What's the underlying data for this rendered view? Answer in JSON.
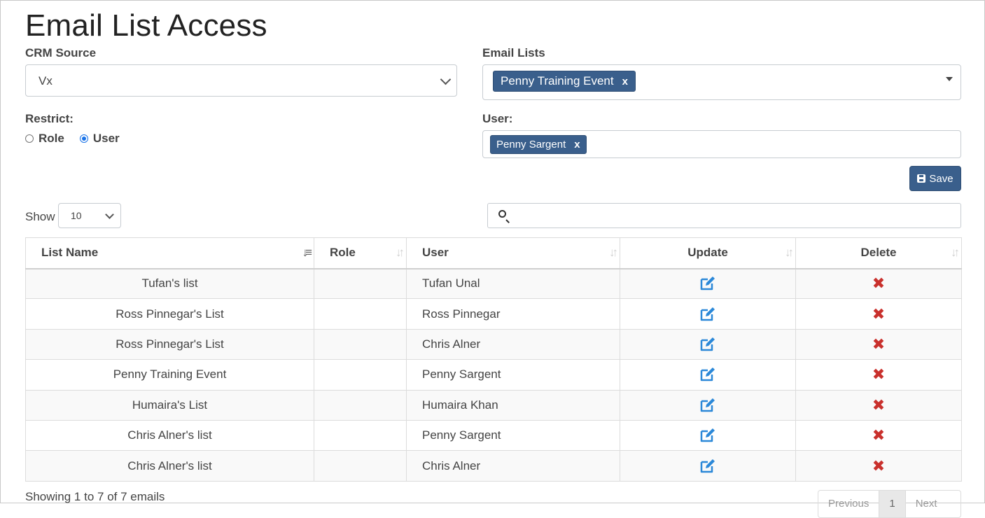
{
  "page": {
    "title": "Email List Access"
  },
  "crm_source": {
    "label": "CRM Source",
    "value": "Vx"
  },
  "email_lists": {
    "label": "Email Lists",
    "tags": [
      {
        "text": "Penny Training Event",
        "remove": "x"
      }
    ]
  },
  "restrict": {
    "label": "Restrict:",
    "options": [
      {
        "label": "Role",
        "selected": false
      },
      {
        "label": "User",
        "selected": true
      }
    ]
  },
  "user": {
    "label": "User:",
    "tags": [
      {
        "text": "Penny Sargent",
        "remove": "x"
      }
    ]
  },
  "save_button": {
    "label": "Save"
  },
  "length": {
    "label": "Show",
    "value": "10"
  },
  "search": {
    "value": ""
  },
  "table": {
    "columns": [
      "List Name",
      "Role",
      "User",
      "Update",
      "Delete"
    ],
    "rows": [
      {
        "list_name": "Tufan's list",
        "role": "",
        "user": "Tufan Unal"
      },
      {
        "list_name": "Ross Pinnegar's List",
        "role": "",
        "user": "Ross Pinnegar"
      },
      {
        "list_name": "Ross Pinnegar's List",
        "role": "",
        "user": "Chris Alner"
      },
      {
        "list_name": "Penny Training Event",
        "role": "",
        "user": "Penny Sargent"
      },
      {
        "list_name": "Humaira's List",
        "role": "",
        "user": "Humaira Khan"
      },
      {
        "list_name": "Chris Alner's list",
        "role": "",
        "user": "Penny Sargent"
      },
      {
        "list_name": "Chris Alner's list",
        "role": "",
        "user": "Chris Alner"
      }
    ]
  },
  "footer": {
    "info": "Showing 1 to 7 of 7 emails",
    "pager": [
      "Previous",
      "1",
      "Next"
    ]
  },
  "colors": {
    "accent": "#3a5f8c",
    "edit": "#2b88d8",
    "delete": "#c9302c"
  },
  "icons": {
    "update": "edit-icon",
    "delete": "delete-x-icon",
    "save": "floppy-disk-icon",
    "search": "search-icon"
  }
}
